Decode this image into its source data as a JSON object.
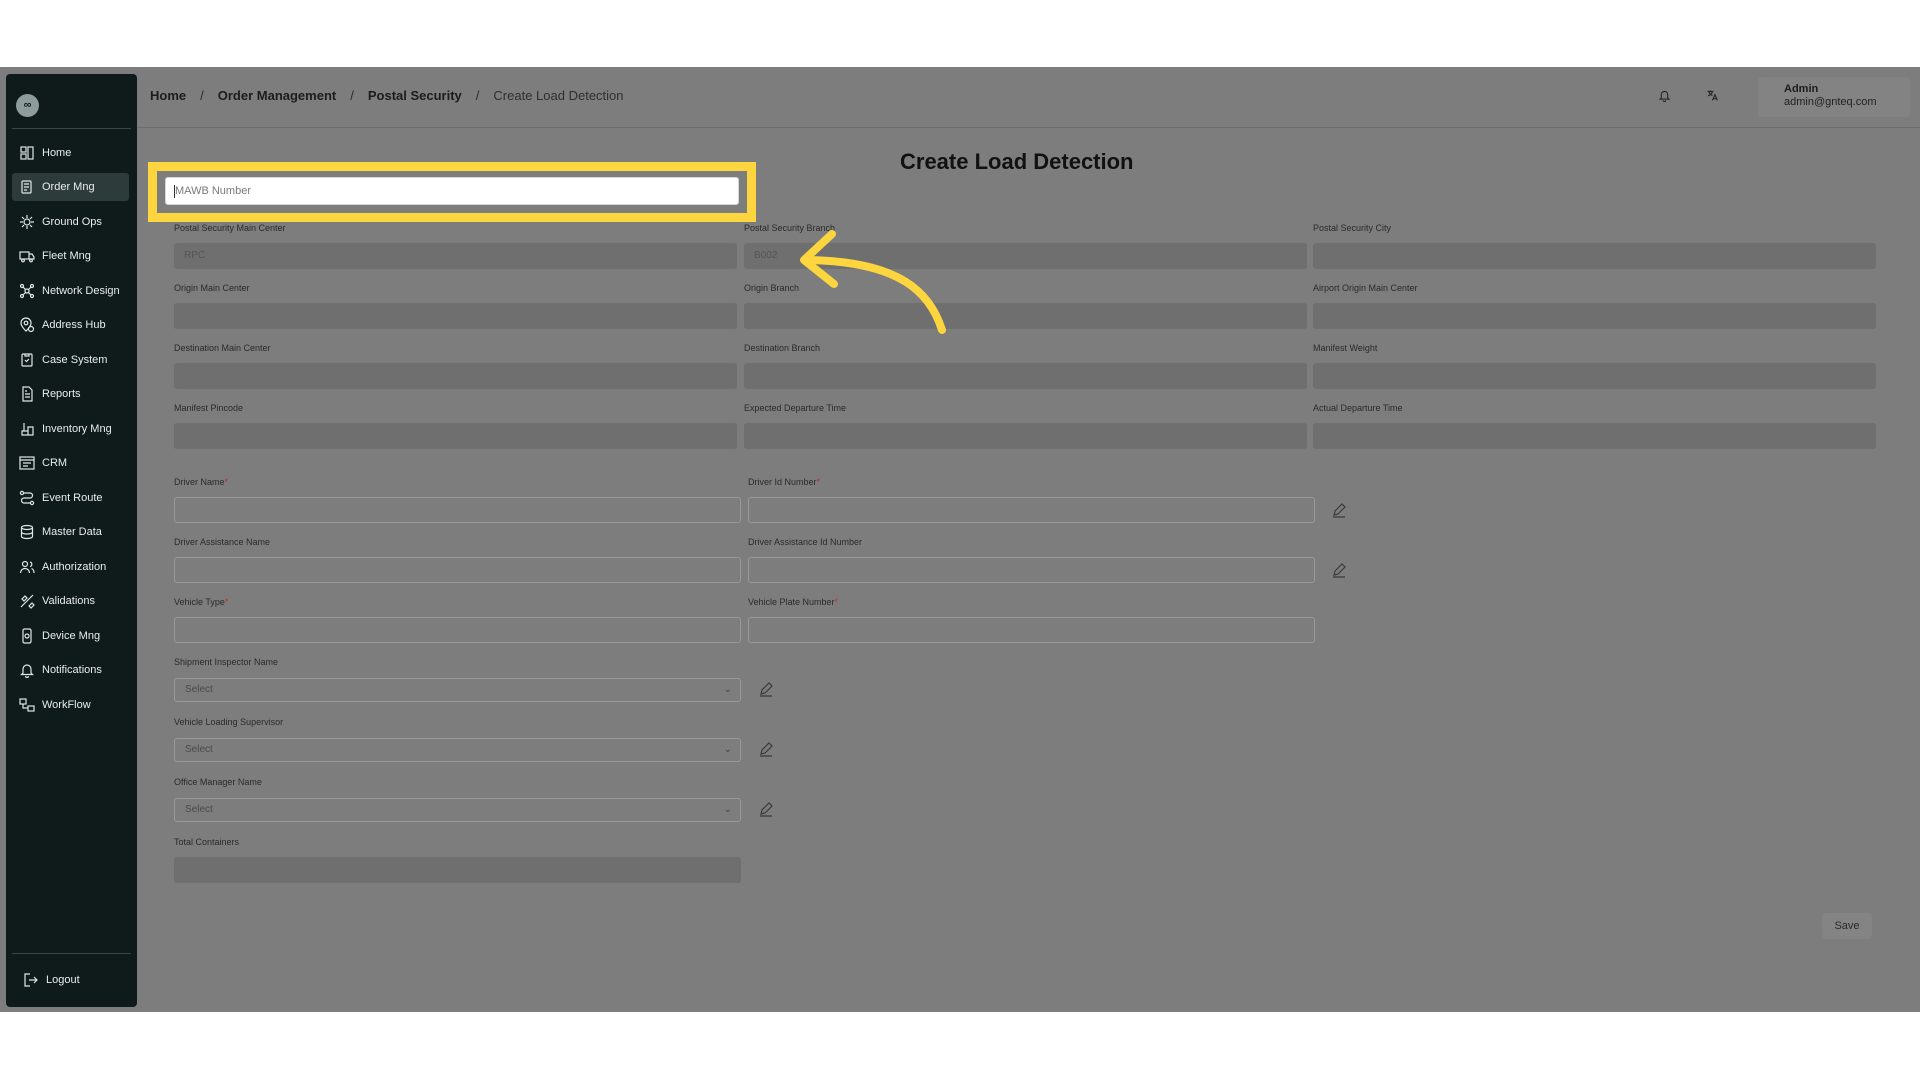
{
  "sidebar": {
    "logo_glyph": "∞",
    "items": [
      {
        "label": "Home",
        "icon": "home-grid-icon"
      },
      {
        "label": "Order Mng",
        "icon": "order-icon",
        "active": true
      },
      {
        "label": "Ground Ops",
        "icon": "ground-ops-icon"
      },
      {
        "label": "Fleet Mng",
        "icon": "truck-icon"
      },
      {
        "label": "Network Design",
        "icon": "network-icon"
      },
      {
        "label": "Address Hub",
        "icon": "address-pin-icon"
      },
      {
        "label": "Case System",
        "icon": "case-icon"
      },
      {
        "label": "Reports",
        "icon": "report-icon"
      },
      {
        "label": "Inventory Mng",
        "icon": "inventory-icon"
      },
      {
        "label": "CRM",
        "icon": "crm-icon"
      },
      {
        "label": "Event Route",
        "icon": "route-icon"
      },
      {
        "label": "Master Data",
        "icon": "database-icon"
      },
      {
        "label": "Authorization",
        "icon": "users-icon"
      },
      {
        "label": "Validations",
        "icon": "validation-icon"
      },
      {
        "label": "Device Mng",
        "icon": "device-icon"
      },
      {
        "label": "Notifications",
        "icon": "bell-icon"
      },
      {
        "label": "WorkFlow",
        "icon": "workflow-icon"
      }
    ],
    "logout_label": "Logout"
  },
  "header": {
    "breadcrumb": [
      "Home",
      "Order Management",
      "Postal Security",
      "Create Load Detection"
    ],
    "breadcrumb_sep": "/",
    "user_name": "Admin",
    "user_email": "admin@gnteq.com"
  },
  "page": {
    "title": "Create Load Detection",
    "mawb_placeholder": "MAWB Number",
    "readonly_fields": [
      {
        "label": "Postal Security Main Center",
        "value": "RPC"
      },
      {
        "label": "Postal Security Branch",
        "value": "B002"
      },
      {
        "label": "Postal Security City",
        "value": ""
      },
      {
        "label": "Origin Main Center",
        "value": ""
      },
      {
        "label": "Origin Branch",
        "value": ""
      },
      {
        "label": "Airport Origin Main Center",
        "value": ""
      },
      {
        "label": "Destination Main Center",
        "value": ""
      },
      {
        "label": "Destination Branch",
        "value": ""
      },
      {
        "label": "Manifest Weight",
        "value": ""
      },
      {
        "label": "Manifest Pincode",
        "value": ""
      },
      {
        "label": "Expected Departure Time",
        "value": ""
      },
      {
        "label": "Actual Departure Time",
        "value": ""
      }
    ],
    "driver_name_label": "Driver Name",
    "driver_id_label": "Driver Id Number",
    "driver_assist_name_label": "Driver Assistance Name",
    "driver_assist_id_label": "Driver Assistance Id Number",
    "vehicle_type_label": "Vehicle Type",
    "vehicle_plate_label": "Vehicle Plate Number",
    "required_mark": "*",
    "inspector_label": "Shipment Inspector Name",
    "supervisor_label": "Vehicle Loading Supervisor",
    "office_manager_label": "Office Manager Name",
    "select_placeholder": "Select",
    "total_containers_label": "Total Containers",
    "save_label": "Save"
  },
  "colors": {
    "highlight": "#fcd53f",
    "arrow": "#fcd53f",
    "sidebar_bg": "#0f1b1b",
    "overlay_bg": "#7d7d7d"
  }
}
